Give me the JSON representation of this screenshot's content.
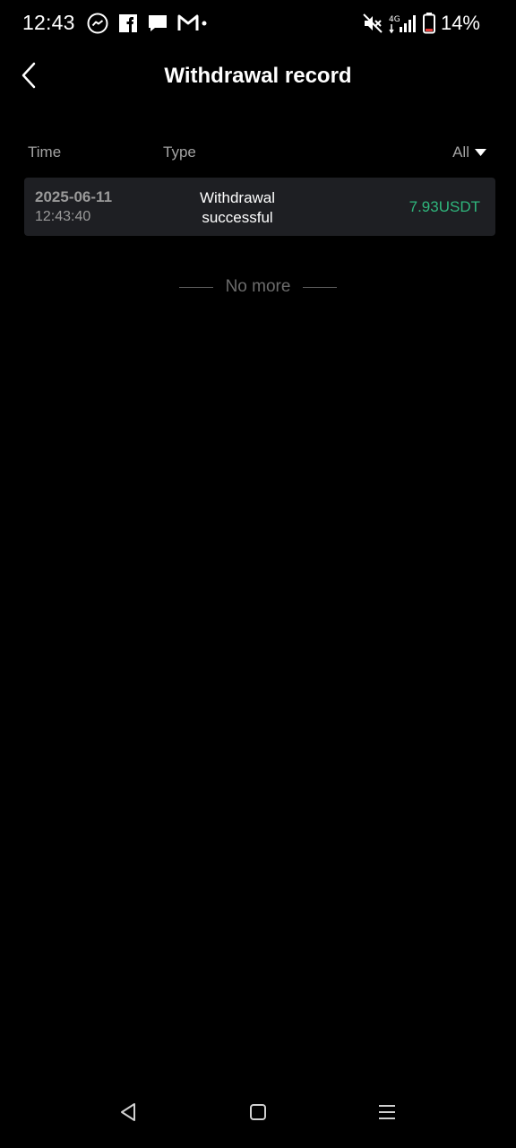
{
  "status_bar": {
    "time": "12:43",
    "battery": "14%",
    "icons_left": [
      "messenger-icon",
      "facebook-icon",
      "message-icon",
      "gmail-icon"
    ],
    "icons_right": [
      "mute-icon",
      "4g-signal-icon",
      "battery-icon"
    ]
  },
  "header": {
    "title": "Withdrawal record"
  },
  "columns": {
    "time": "Time",
    "type": "Type",
    "filter": "All"
  },
  "records": [
    {
      "date": "2025-06-11",
      "time": "12:43:40",
      "type_line1": "Withdrawal",
      "type_line2": "successful",
      "amount": "7.93USDT"
    }
  ],
  "footer": {
    "no_more": "No more"
  },
  "colors": {
    "background": "#000000",
    "card": "#1e1f23",
    "amount": "#2fb67c",
    "muted": "#9a9a9a"
  }
}
